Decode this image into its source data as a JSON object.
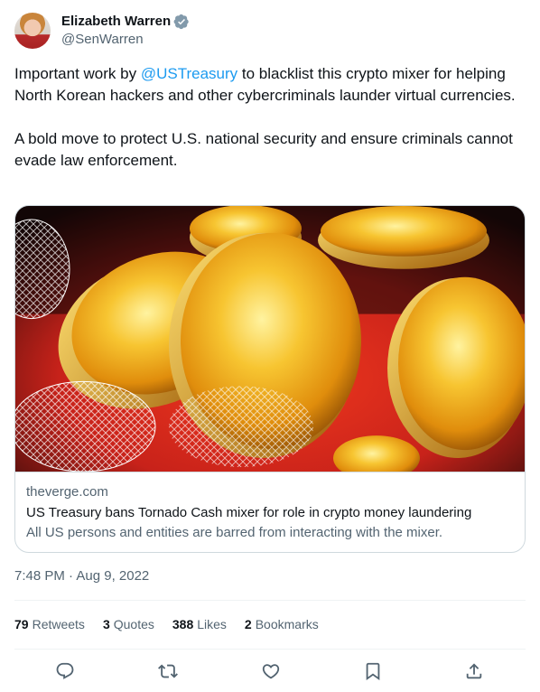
{
  "author": {
    "display_name": "Elizabeth Warren",
    "handle": "@SenWarren",
    "verified_icon": "verified-badge-icon",
    "verified_color": "#829aab"
  },
  "tweet": {
    "part1": "Important work by ",
    "mention": "@USTreasury",
    "part2": " to blacklist this crypto mixer for helping North Korean hackers and other cybercriminals launder virtual currencies.",
    "paragraph2": "A bold move to protect U.S. national security and ensure criminals cannot evade law enforcement.",
    "mention_color": "#1d9bf0"
  },
  "card": {
    "domain": "theverge.com",
    "title": "US Treasury bans Tornado Cash mixer for role in crypto money laundering",
    "description": "All US persons and entities are barred from interacting with the mixer."
  },
  "timestamp": "7:48 PM · Aug 9, 2022",
  "stats": {
    "retweets_count": "79",
    "retweets_label": "Retweets",
    "quotes_count": "3",
    "quotes_label": "Quotes",
    "likes_count": "388",
    "likes_label": "Likes",
    "bookmarks_count": "2",
    "bookmarks_label": "Bookmarks"
  },
  "actions": [
    "reply-icon",
    "retweet-icon",
    "like-icon",
    "bookmark-icon",
    "share-icon"
  ],
  "colors": {
    "text": "#0f1419",
    "secondary": "#536471",
    "border": "#cfd9de",
    "accent": "#1d9bf0"
  }
}
